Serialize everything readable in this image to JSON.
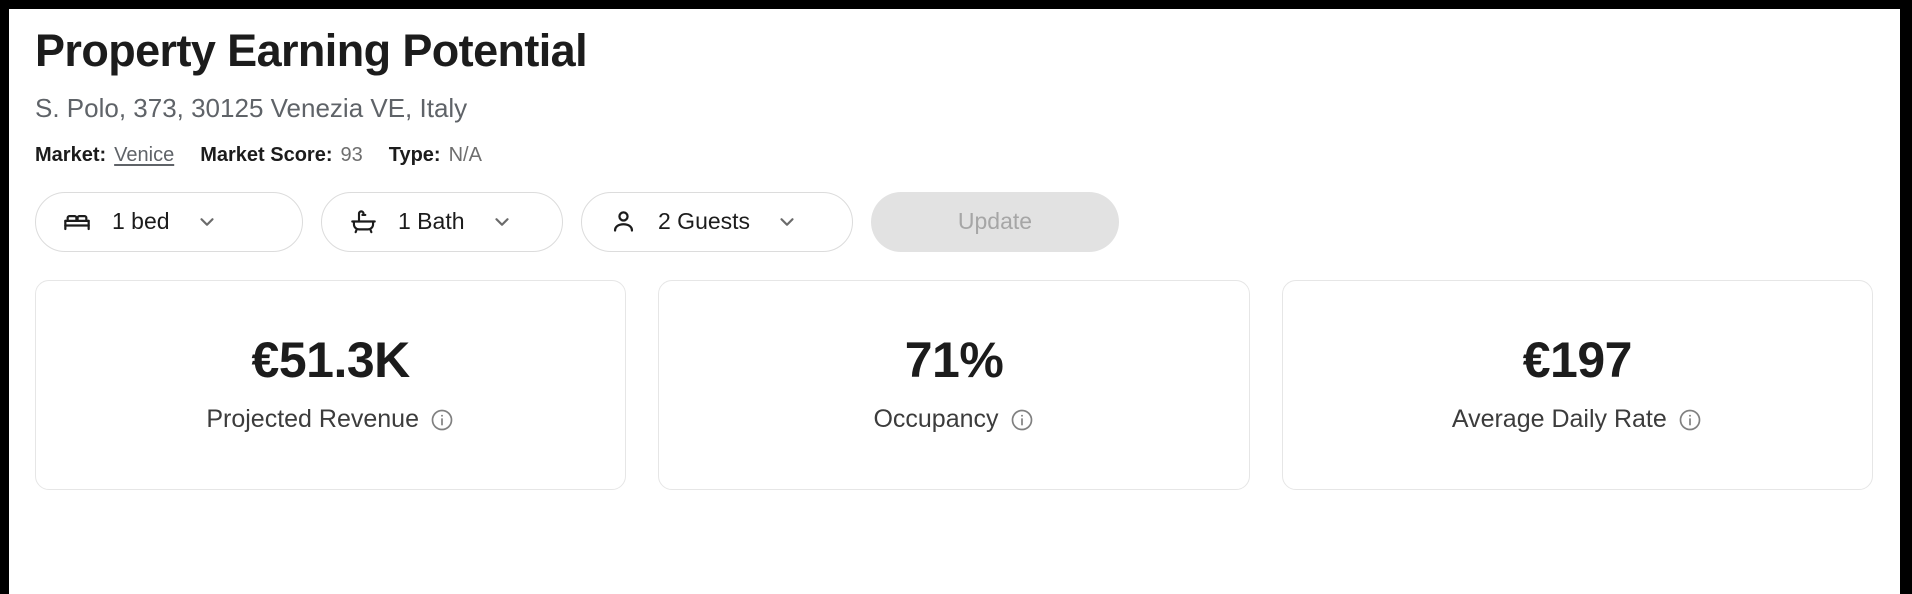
{
  "page": {
    "title": "Property Earning Potential",
    "address": "S. Polo, 373, 30125 Venezia VE, Italy"
  },
  "meta": {
    "market_label": "Market:",
    "market_value": "Venice",
    "market_score_label": "Market Score:",
    "market_score_value": "93",
    "type_label": "Type:",
    "type_value": "N/A"
  },
  "controls": {
    "bed": {
      "value": "1 bed",
      "icon": "bed-icon",
      "chevron": "chevron-down-icon"
    },
    "bath": {
      "value": "1 Bath",
      "icon": "bathtub-icon",
      "chevron": "chevron-down-icon"
    },
    "guests": {
      "value": "2 Guests",
      "icon": "person-icon",
      "chevron": "chevron-down-icon"
    },
    "update_label": "Update"
  },
  "stats": [
    {
      "value": "€51.3K",
      "label": "Projected Revenue",
      "info_icon": "info-icon"
    },
    {
      "value": "71%",
      "label": "Occupancy",
      "info_icon": "info-icon"
    },
    {
      "value": "€197",
      "label": "Average Daily Rate",
      "info_icon": "info-icon"
    }
  ],
  "colors": {
    "text_primary": "#1c1c1c",
    "text_secondary": "#5f6368",
    "card_border": "#e6e6e6",
    "pill_border": "#dcdcdc",
    "disabled_button_bg": "#e2e2e2",
    "disabled_button_text": "#a6a6a6",
    "frame": "#000000"
  }
}
